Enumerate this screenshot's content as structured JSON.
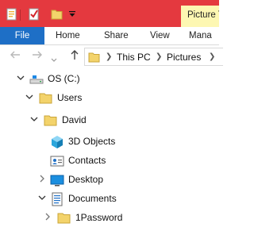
{
  "titlebar": {
    "quick_access_icons": [
      "properties-icon",
      "checkmark-icon",
      "new-folder-icon",
      "customize-dropdown-icon"
    ],
    "context_tab_label": "Picture T"
  },
  "ribbon": {
    "tabs": [
      {
        "label": "File"
      },
      {
        "label": "Home"
      },
      {
        "label": "Share"
      },
      {
        "label": "View"
      },
      {
        "label": "Mana"
      }
    ]
  },
  "address": {
    "crumbs": [
      {
        "label": "This PC"
      },
      {
        "label": "Pictures"
      }
    ]
  },
  "tree": {
    "items": [
      {
        "label": "OS (C:)",
        "icon": "drive-icon",
        "state": "expanded"
      },
      {
        "label": "Users",
        "icon": "folder-icon",
        "state": "expanded"
      },
      {
        "label": "David",
        "icon": "folder-icon",
        "state": "expanded"
      },
      {
        "label": "3D Objects",
        "icon": "cube-icon",
        "state": "none"
      },
      {
        "label": "Contacts",
        "icon": "contacts-icon",
        "state": "none"
      },
      {
        "label": "Desktop",
        "icon": "desktop-icon",
        "state": "collapsed"
      },
      {
        "label": "Documents",
        "icon": "documents-icon",
        "state": "expanded"
      },
      {
        "label": "1Password",
        "icon": "folder-icon",
        "state": "collapsed"
      }
    ]
  },
  "colors": {
    "titlebar": "#e4393f",
    "file_tab": "#1e6fc6",
    "context_tab": "#fdf7b2",
    "folder": "#f3d36b"
  }
}
